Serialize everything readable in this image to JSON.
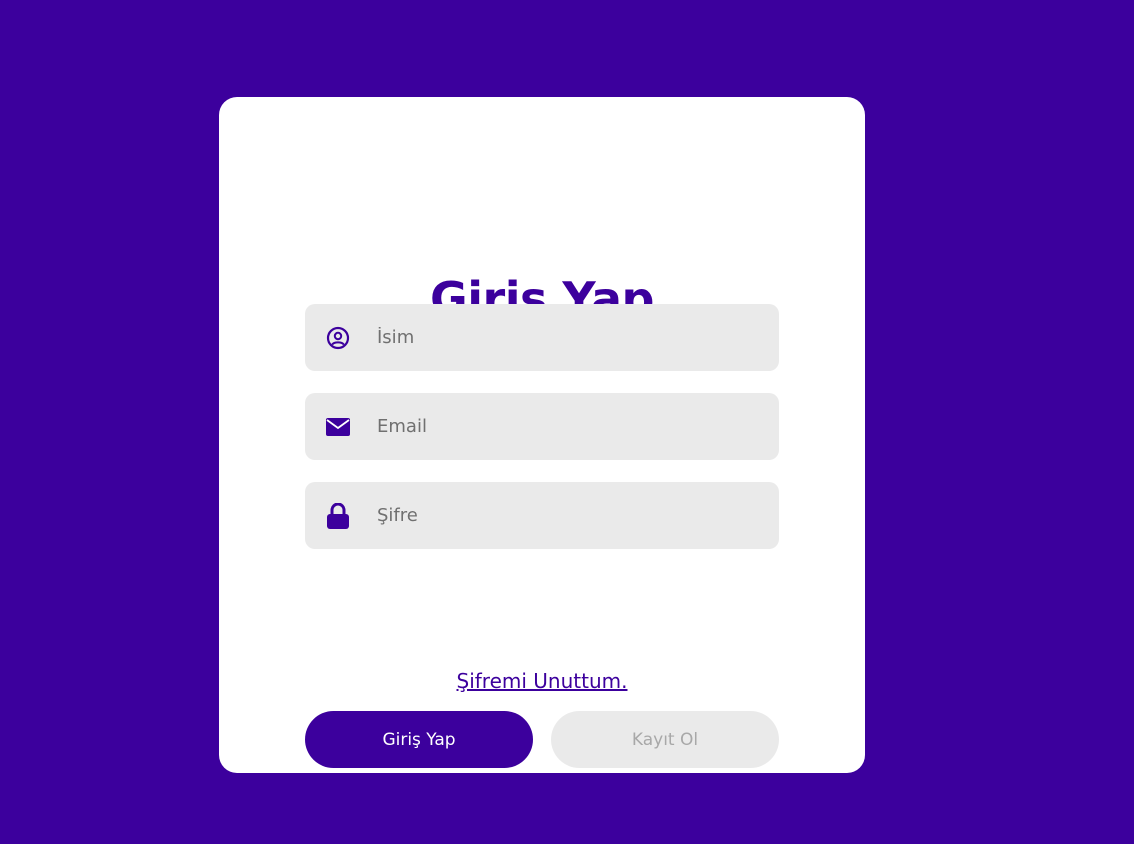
{
  "form": {
    "title": "Giriş Yap",
    "fields": [
      {
        "placeholder": "İsim",
        "icon": "user-circle-icon",
        "value": ""
      },
      {
        "placeholder": "Email",
        "icon": "envelope-icon",
        "value": ""
      },
      {
        "placeholder": "Şifre",
        "icon": "lock-icon",
        "value": ""
      }
    ],
    "forgot_password": "Şifremi Unuttum.",
    "login_label": "Giriş Yap",
    "register_label": "Kayıt Ol"
  },
  "colors": {
    "background": "#3c009d",
    "card": "#ffffff",
    "accent": "#3c009d",
    "field_bg": "#eaeaea",
    "inactive_text": "#a8a8a8"
  }
}
